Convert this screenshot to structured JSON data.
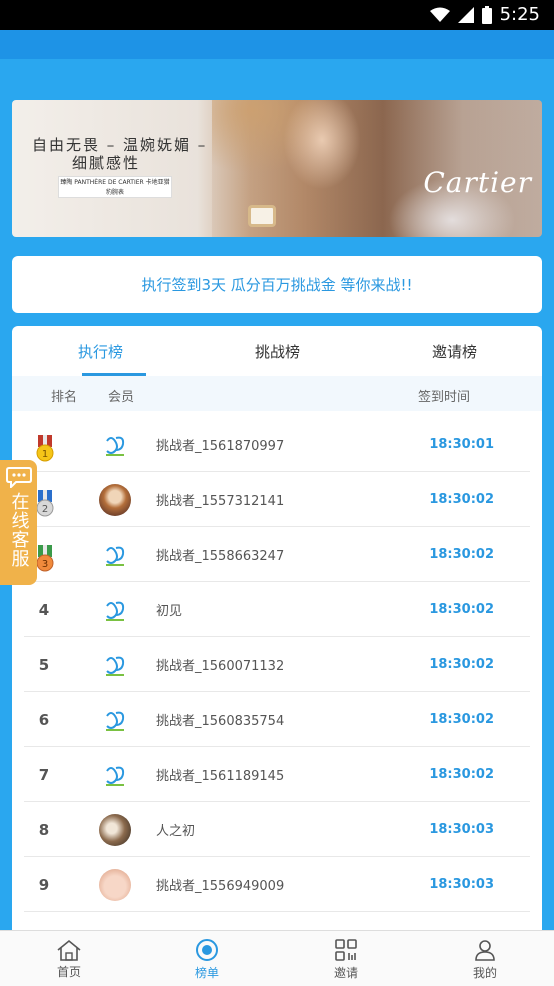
{
  "status_bar": {
    "time": "5:25"
  },
  "banner": {
    "line1": "自由无畏 – 温婉妩媚 –",
    "line2": "细腻感性",
    "tag": "臻陶 PANTHÈRE DE CARTIER 卡地亚猎豹腕表",
    "brand": "Cartier"
  },
  "promo_text": "执行签到3天 瓜分百万挑战金 等你来战!!",
  "tabs": [
    {
      "label": "执行榜",
      "active": true
    },
    {
      "label": "挑战榜",
      "active": false
    },
    {
      "label": "邀请榜",
      "active": false
    }
  ],
  "table_header": {
    "rank": "排名",
    "member": "会员",
    "time": "签到时间"
  },
  "rows": [
    {
      "rank": "1",
      "medal": "gold",
      "avatar": "logo",
      "name": "挑战者_1561870997",
      "time": "18:30:01"
    },
    {
      "rank": "2",
      "medal": "silver",
      "avatar": "photo1",
      "name": "挑战者_1557312141",
      "time": "18:30:02"
    },
    {
      "rank": "3",
      "medal": "bronze",
      "avatar": "logo",
      "name": "挑战者_1558663247",
      "time": "18:30:02"
    },
    {
      "rank": "4",
      "avatar": "logo",
      "name": "初见",
      "time": "18:30:02"
    },
    {
      "rank": "5",
      "avatar": "logo",
      "name": "挑战者_1560071132",
      "time": "18:30:02"
    },
    {
      "rank": "6",
      "avatar": "logo",
      "name": "挑战者_1560835754",
      "time": "18:30:02"
    },
    {
      "rank": "7",
      "avatar": "logo",
      "name": "挑战者_1561189145",
      "time": "18:30:02"
    },
    {
      "rank": "8",
      "avatar": "photo2",
      "name": "人之初",
      "time": "18:30:03"
    },
    {
      "rank": "9",
      "avatar": "photo3",
      "name": "挑战者_1556949009",
      "time": "18:30:03"
    }
  ],
  "customer_service": "在线客服",
  "bottom_nav": [
    {
      "label": "首页",
      "icon": "home-icon",
      "active": false
    },
    {
      "label": "榜单",
      "icon": "ranking-icon",
      "active": true
    },
    {
      "label": "邀请",
      "icon": "grid-icon",
      "active": false
    },
    {
      "label": "我的",
      "icon": "user-icon",
      "active": false
    }
  ],
  "colors": {
    "accent": "#2a98e0",
    "page_bg": "#2aa7ef",
    "service_bg": "#f0b24a"
  }
}
